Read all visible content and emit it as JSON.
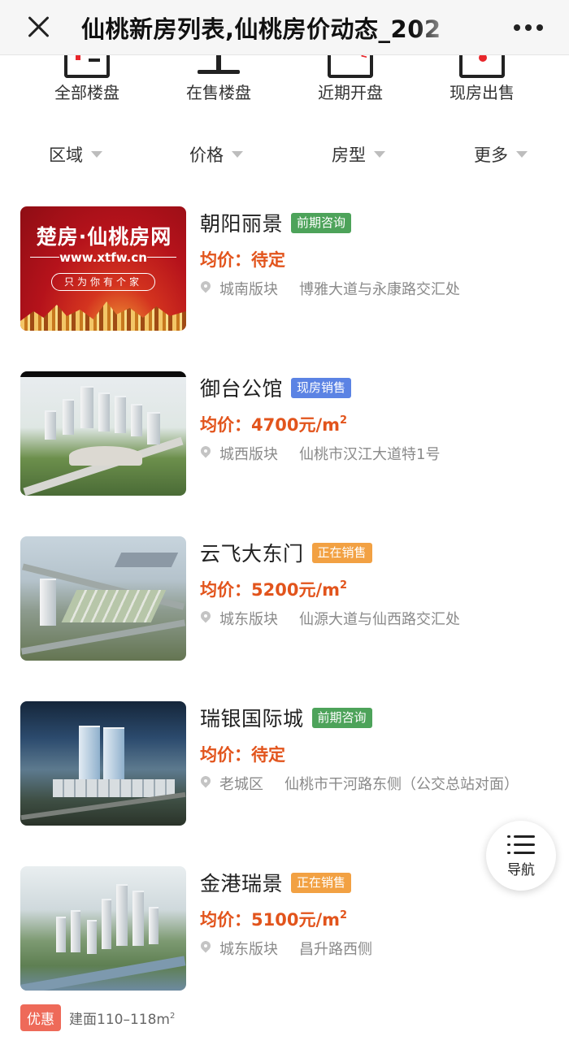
{
  "header": {
    "title": "仙桃新房列表,仙桃房价动态_202",
    "close_icon": "close-icon",
    "more_icon": "more-dots-icon"
  },
  "categories": [
    {
      "label": "全部楼盘",
      "icon": "all-buildings-icon"
    },
    {
      "label": "在售楼盘",
      "icon": "on-sale-icon"
    },
    {
      "label": "近期开盘",
      "icon": "new-opening-icon"
    },
    {
      "label": "现房出售",
      "icon": "ready-house-icon"
    }
  ],
  "filters": [
    {
      "label": "区域"
    },
    {
      "label": "价格"
    },
    {
      "label": "房型"
    },
    {
      "label": "更多"
    }
  ],
  "listings": [
    {
      "name": "朝阳丽景",
      "tag": "前期咨询",
      "tag_color": "#4da35a",
      "price": "均价：待定",
      "district": "城南版块",
      "address": "博雅大道与永康路交汇处",
      "thumb_text": {
        "title": "楚房·仙桃房网",
        "url": "www.xtfw.cn",
        "slogan": "只为你有个家"
      }
    },
    {
      "name": "御台公馆",
      "tag": "现房销售",
      "tag_color": "#5b83e4",
      "price": "均价：4700元/m",
      "price_sup": "2",
      "district": "城西版块",
      "address": "仙桃市汉江大道特1号"
    },
    {
      "name": "云飞大东门",
      "tag": "正在销售",
      "tag_color": "#f2a143",
      "price": "均价：5200元/m",
      "price_sup": "2",
      "district": "城东版块",
      "address": "仙源大道与仙西路交汇处"
    },
    {
      "name": "瑞银国际城",
      "tag": "前期咨询",
      "tag_color": "#4da35a",
      "price": "均价：待定",
      "district": "老城区",
      "address": "仙桃市干河路东侧（公交总站对面）"
    },
    {
      "name": "金港瑞景",
      "tag": "正在销售",
      "tag_color": "#f2a143",
      "price": "均价：5100元/m",
      "price_sup": "2",
      "district": "城东版块",
      "address": "昌升路西侧"
    }
  ],
  "promo": {
    "badge": "优惠",
    "area": "建面110–118m",
    "area_sup": "2"
  },
  "fab": {
    "label": "导航",
    "icon": "menu-list-icon"
  }
}
